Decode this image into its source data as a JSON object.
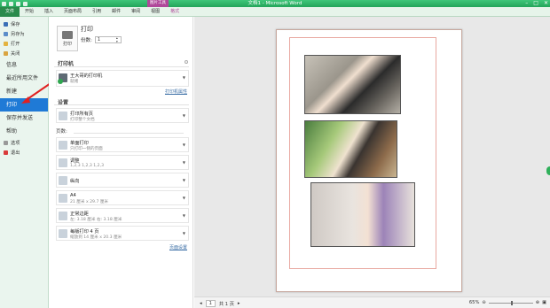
{
  "titlebar": {
    "title": "文档1 - Microsoft Word",
    "context_tab": "图片工具",
    "minimize": "–",
    "maximize": "□",
    "close": "✕"
  },
  "tabs": [
    "文件",
    "开始",
    "插入",
    "页面布局",
    "引用",
    "邮件",
    "审阅",
    "视图",
    "格式"
  ],
  "nav": {
    "small_items": [
      {
        "label": "保存",
        "icon": "save-icon"
      },
      {
        "label": "另存为",
        "icon": "save-as-icon"
      },
      {
        "label": "打开",
        "icon": "open-icon"
      },
      {
        "label": "关闭",
        "icon": "close-doc-icon"
      }
    ],
    "info": "信息",
    "recent": "最近所用文件",
    "new": "新建",
    "print": "打印",
    "save_send": "保存并发送",
    "help": "帮助",
    "options": "选项",
    "exit": "退出"
  },
  "print": {
    "heading": "打印",
    "button_label": "打印",
    "copies_label": "份数:",
    "copies_value": "1",
    "printer_section": "打印机",
    "printer_name": "王大哥的打印机",
    "printer_status": "就绪",
    "printer_properties": "打印机属性",
    "settings_section": "设置",
    "pages_label": "页数:",
    "page_setup": "页面设置",
    "options": [
      {
        "title": "打印所有页",
        "sub": "打印整个文档"
      },
      {
        "title": "单面打印",
        "sub": "只打印一侧的页面"
      },
      {
        "title": "调整",
        "sub": "1,2,3    1,2,3    1,2,3"
      },
      {
        "title": "纵向",
        "sub": ""
      },
      {
        "title": "A4",
        "sub": "21 厘米 x 29.7 厘米"
      },
      {
        "title": "正常边距",
        "sub": "左: 3.18 厘米    右: 3.18 厘米"
      },
      {
        "title": "每版打印 4 页",
        "sub": "缩放到 14 厘米 x 20.3 厘米"
      }
    ]
  },
  "status": {
    "page_current": "1",
    "page_total": "共 1 页",
    "zoom": "65%",
    "zoom_level": 0.65
  }
}
